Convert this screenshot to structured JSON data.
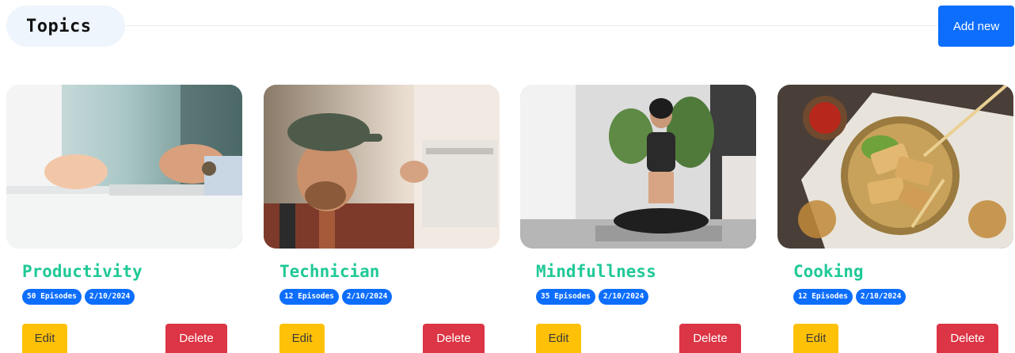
{
  "header": {
    "title": "Topics",
    "add_new_label": "Add new"
  },
  "cards": [
    {
      "title": "Productivity",
      "episodes": "50 Episodes",
      "date": "2/10/2024",
      "image": "business-meeting-hands-photo",
      "edit_label": "Edit",
      "delete_label": "Delete"
    },
    {
      "title": "Technician",
      "episodes": "12 Episodes",
      "date": "2/10/2024",
      "image": "technician-repairing-air-conditioner-photo",
      "edit_label": "Edit",
      "delete_label": "Delete"
    },
    {
      "title": "Mindfullness",
      "episodes": "35 Episodes",
      "date": "2/10/2024",
      "image": "woman-meditating-yoga-photo",
      "edit_label": "Edit",
      "delete_label": "Delete"
    },
    {
      "title": "Cooking",
      "episodes": "12 Episodes",
      "date": "2/10/2024",
      "image": "spring-rolls-food-photo",
      "edit_label": "Edit",
      "delete_label": "Delete"
    }
  ],
  "colors": {
    "primary": "#0d6efd",
    "title_green": "#20c997",
    "edit_yellow": "#ffc107",
    "delete_red": "#dc3545",
    "pill_bg": "#eef5fc"
  }
}
